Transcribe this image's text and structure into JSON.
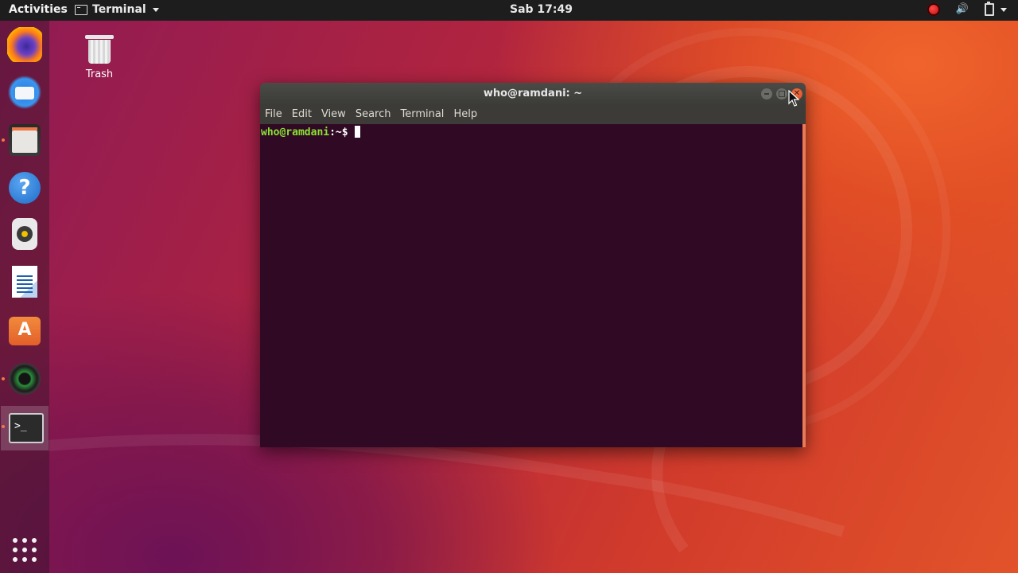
{
  "topbar": {
    "activities": "Activities",
    "app_menu": "Terminal",
    "clock": "Sab 17:49"
  },
  "desktop": {
    "trash_label": "Trash"
  },
  "dock": {
    "items": [
      "firefox-icon",
      "thunderbird-icon",
      "files-icon",
      "help-icon",
      "rhythmbox-icon",
      "libreoffice-writer-icon",
      "software-center-icon",
      "cheese-icon",
      "terminal-icon"
    ],
    "show_apps": "apps-grid-icon"
  },
  "terminal_window": {
    "title": "who@ramdani: ~",
    "menu": [
      "File",
      "Edit",
      "View",
      "Search",
      "Terminal",
      "Help"
    ],
    "prompt_user": "who@ramdani",
    "prompt_rest": ":~$ ",
    "colors": {
      "background": "#300a24",
      "prompt": "#8ae234",
      "close": "#e45b2a"
    }
  }
}
